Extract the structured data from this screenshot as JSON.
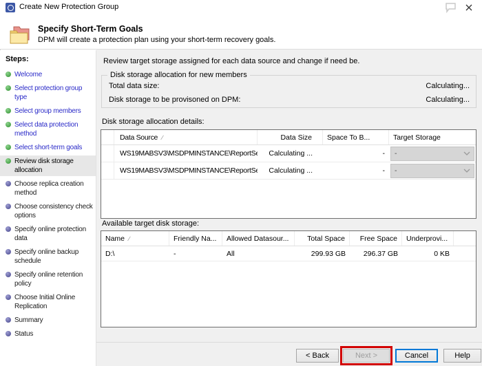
{
  "window": {
    "title": "Create New Protection Group"
  },
  "header": {
    "title": "Specify Short-Term Goals",
    "subtitle": "DPM will create a protection plan using your short-term recovery goals."
  },
  "sidebar": {
    "heading": "Steps:",
    "items": [
      {
        "label": "Welcome",
        "state": "done"
      },
      {
        "label": "Select protection group type",
        "state": "done"
      },
      {
        "label": "Select group members",
        "state": "done"
      },
      {
        "label": "Select data protection method",
        "state": "done"
      },
      {
        "label": "Select short-term goals",
        "state": "done"
      },
      {
        "label": "Review disk storage allocation",
        "state": "current"
      },
      {
        "label": "Choose replica creation method",
        "state": "pending"
      },
      {
        "label": "Choose consistency check options",
        "state": "pending"
      },
      {
        "label": "Specify online protection data",
        "state": "pending"
      },
      {
        "label": "Specify online backup schedule",
        "state": "pending"
      },
      {
        "label": "Specify online retention policy",
        "state": "pending"
      },
      {
        "label": "Choose Initial Online Replication",
        "state": "pending"
      },
      {
        "label": "Summary",
        "state": "pending"
      },
      {
        "label": "Status",
        "state": "pending"
      }
    ]
  },
  "main": {
    "intro": "Review target storage assigned for each data source and change if need be.",
    "allocation_box": {
      "title": "Disk storage allocation for new members",
      "rows": [
        {
          "label": "Total data size:",
          "value": "Calculating..."
        },
        {
          "label": "Disk storage to be provisoned on DPM:",
          "value": "Calculating..."
        }
      ]
    },
    "details": {
      "label": "Disk storage allocation details:",
      "columns": [
        "Data Source",
        "Data Size",
        "Space To B...",
        "Target Storage"
      ],
      "rows": [
        {
          "data_source": "WS19MABSV3\\MSDPMINSTANCE\\ReportServe...",
          "data_size": "Calculating ...",
          "space_to_b": "-",
          "target_storage": "-"
        },
        {
          "data_source": "WS19MABSV3\\MSDPMINSTANCE\\ReportServe...",
          "data_size": "Calculating ...",
          "space_to_b": "-",
          "target_storage": "-"
        }
      ]
    },
    "available": {
      "label": "Available target disk storage:",
      "columns": [
        "Name",
        "Friendly Na...",
        "Allowed Datasour...",
        "Total Space",
        "Free Space",
        "Underprovi..."
      ],
      "rows": [
        {
          "name": "D:\\",
          "friendly_name": "-",
          "allowed_datasources": "All",
          "total_space": "299.93 GB",
          "free_space": "296.37 GB",
          "underprovisioned": "0 KB"
        }
      ]
    }
  },
  "footer": {
    "back_label": "< Back",
    "next_label": "Next >",
    "cancel_label": "Cancel",
    "help_label": "Help"
  },
  "icons": {
    "sort_glyph": "∕"
  },
  "colors": {
    "link_done_step": "#2a2ac8",
    "done_bullet_green": "#2e8f2e",
    "pending_bullet_purple": "#45458c",
    "next_annotation_red": "#d20000",
    "cancel_focus_blue": "#0078d7",
    "main_background": "#f0f0f0"
  }
}
